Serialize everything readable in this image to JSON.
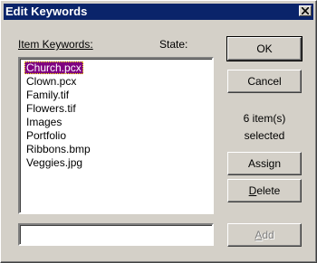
{
  "window": {
    "title": "Edit Keywords"
  },
  "labels": {
    "item_keywords": "Item Keywords:",
    "state": "State:"
  },
  "list": {
    "items": [
      "Church.pcx",
      "Clown.pcx",
      "Family.tif",
      "Flowers.tif",
      "Images",
      "Portfolio",
      "Ribbons.bmp",
      "Veggies.jpg"
    ],
    "selected_index": 0
  },
  "keyword_input": {
    "value": ""
  },
  "buttons": {
    "ok": "OK",
    "cancel": "Cancel",
    "assign_pre": "Assi",
    "assign_ul": "g",
    "assign_post": "n",
    "delete_ul": "D",
    "delete_post": "elete",
    "add_ul": "A",
    "add_post": "dd"
  },
  "status": {
    "line1": "6 item(s)",
    "line2": "selected"
  },
  "colors": {
    "titlebar": "#0a246a",
    "selection": "#800080",
    "face": "#d4d0c8"
  }
}
